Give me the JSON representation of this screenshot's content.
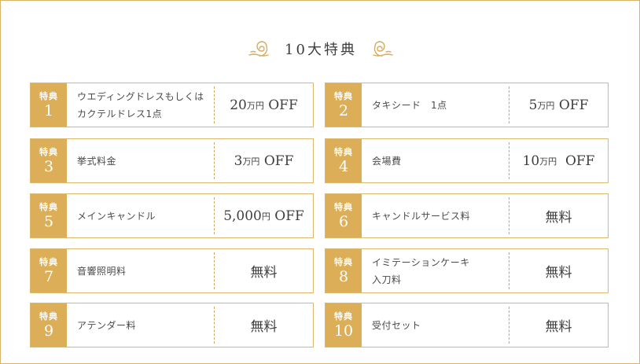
{
  "heading": {
    "title": "10大特典"
  },
  "benefits": [
    {
      "badge": "特典",
      "num": "1",
      "item": "ウエディングドレスもしくは\nカクテルドレス1点",
      "amount": "20",
      "unit": "万円",
      "suffix": " OFF"
    },
    {
      "badge": "特典",
      "num": "2",
      "item": "タキシード　1点",
      "amount": "5",
      "unit": "万円",
      "suffix": " OFF"
    },
    {
      "badge": "特典",
      "num": "3",
      "item": "挙式料金",
      "amount": "3",
      "unit": "万円",
      "suffix": " OFF"
    },
    {
      "badge": "特典",
      "num": "4",
      "item": "会場費",
      "amount": "10",
      "unit": "万円",
      "suffix": "  OFF"
    },
    {
      "badge": "特典",
      "num": "5",
      "item": "メインキャンドル",
      "amount": "5,000",
      "unit": "円",
      "suffix": " OFF"
    },
    {
      "badge": "特典",
      "num": "6",
      "item": "キャンドルサービス料",
      "amount": "無料",
      "unit": "",
      "suffix": ""
    },
    {
      "badge": "特典",
      "num": "7",
      "item": "音響照明料",
      "amount": "無料",
      "unit": "",
      "suffix": ""
    },
    {
      "badge": "特典",
      "num": "8",
      "item": "イミテーションケーキ\n入刀料",
      "amount": "無料",
      "unit": "",
      "suffix": ""
    },
    {
      "badge": "特典",
      "num": "9",
      "item": "アテンダー料",
      "amount": "無料",
      "unit": "",
      "suffix": ""
    },
    {
      "badge": "特典",
      "num": "10",
      "item": "受付セット",
      "amount": "無料",
      "unit": "",
      "suffix": ""
    }
  ],
  "colors": {
    "gold": "#dcae57",
    "border": "#dcb86e",
    "text": "#4a4a4a"
  },
  "icons": {
    "title_left": "swirl-ornament-icon",
    "title_right": "swirl-ornament-icon"
  }
}
